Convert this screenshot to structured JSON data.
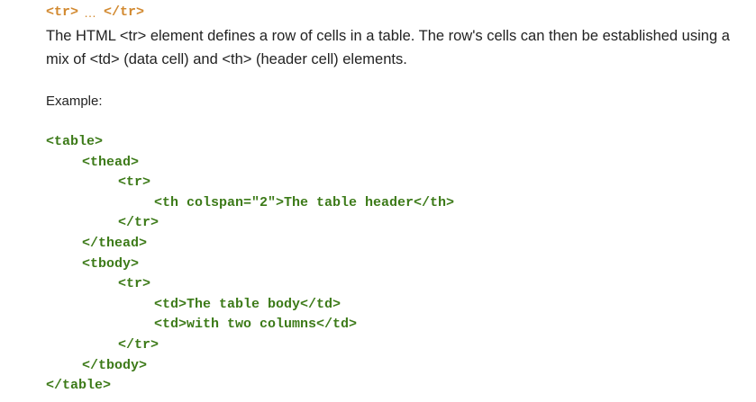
{
  "element": {
    "open_tag": "<tr>",
    "ellipsis": "…",
    "close_tag": "</tr>"
  },
  "description": "The HTML <tr> element defines a row of cells in a table. The row's cells can then be established using a mix of <td> (data cell) and <th> (header cell) elements.",
  "example_label": "Example:",
  "code_lines": [
    {
      "indent": 0,
      "text": "<table>"
    },
    {
      "indent": 1,
      "text": "<thead>"
    },
    {
      "indent": 2,
      "text": "<tr>"
    },
    {
      "indent": 3,
      "text": "<th colspan=\"2\">The table header</th>"
    },
    {
      "indent": 2,
      "text": "</tr>"
    },
    {
      "indent": 1,
      "text": "</thead>"
    },
    {
      "indent": 1,
      "text": "<tbody>"
    },
    {
      "indent": 2,
      "text": "<tr>"
    },
    {
      "indent": 3,
      "text": "<td>The table body</td>"
    },
    {
      "indent": 3,
      "text": "<td>with two columns</td>"
    },
    {
      "indent": 2,
      "text": "</tr>"
    },
    {
      "indent": 1,
      "text": "</tbody>"
    },
    {
      "indent": 0,
      "text": "</table>"
    }
  ],
  "colors": {
    "title": "#d2892f",
    "code": "#3c7a18",
    "text": "#222222"
  }
}
